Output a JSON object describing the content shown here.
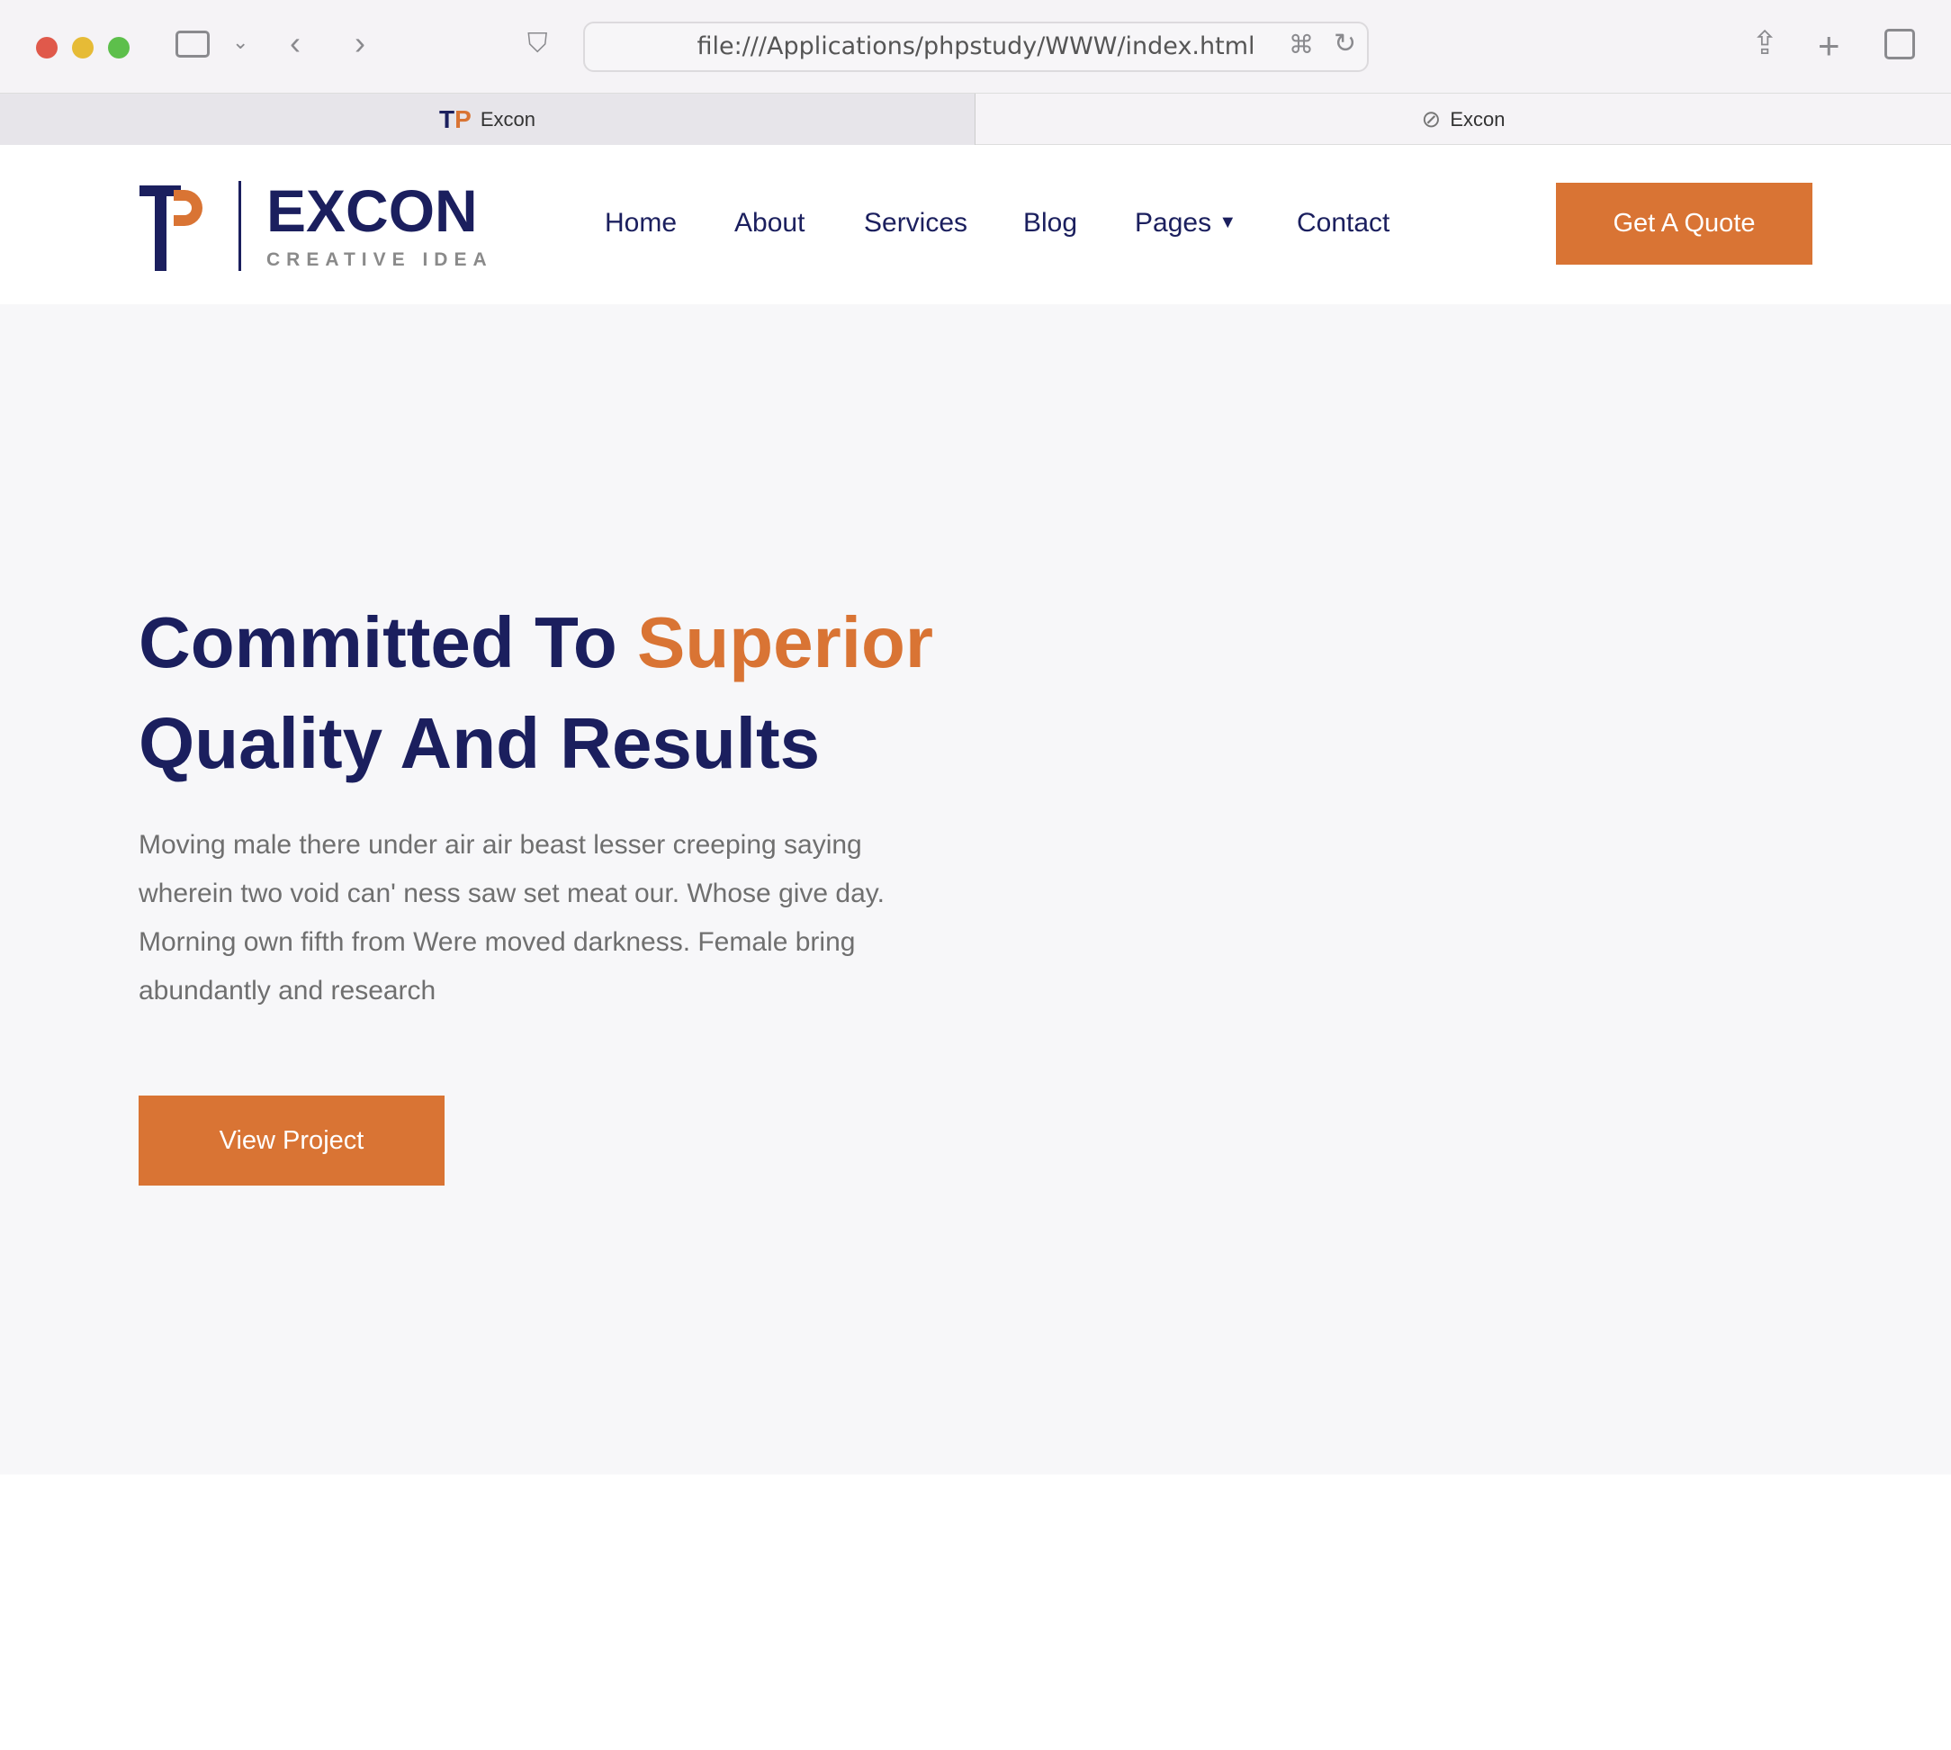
{
  "browser": {
    "url": "file:///Applications/phpstudy/WWW/index.html",
    "tabs": [
      {
        "title": "Excon",
        "active": true
      },
      {
        "title": "Excon",
        "active": false
      }
    ]
  },
  "nav": {
    "brand": "EXCON",
    "tagline": "CREATIVE IDEA",
    "items": [
      "Home",
      "About",
      "Services",
      "Blog",
      "Pages",
      "Contact"
    ],
    "cta": "Get A Quote"
  },
  "hero": {
    "title_part1": "Committed To ",
    "title_accent": "Superior",
    "title_part2": "Quality And Results",
    "paragraph": "Moving male there under air air beast lesser creeping saying wherein two void can' ness saw set meat our. Whose give day. Morning own fifth from Were moved darkness. Female bring abundantly and research",
    "button": "View Project"
  },
  "colors": {
    "primary": "#1b1f5e",
    "accent": "#d97434"
  }
}
